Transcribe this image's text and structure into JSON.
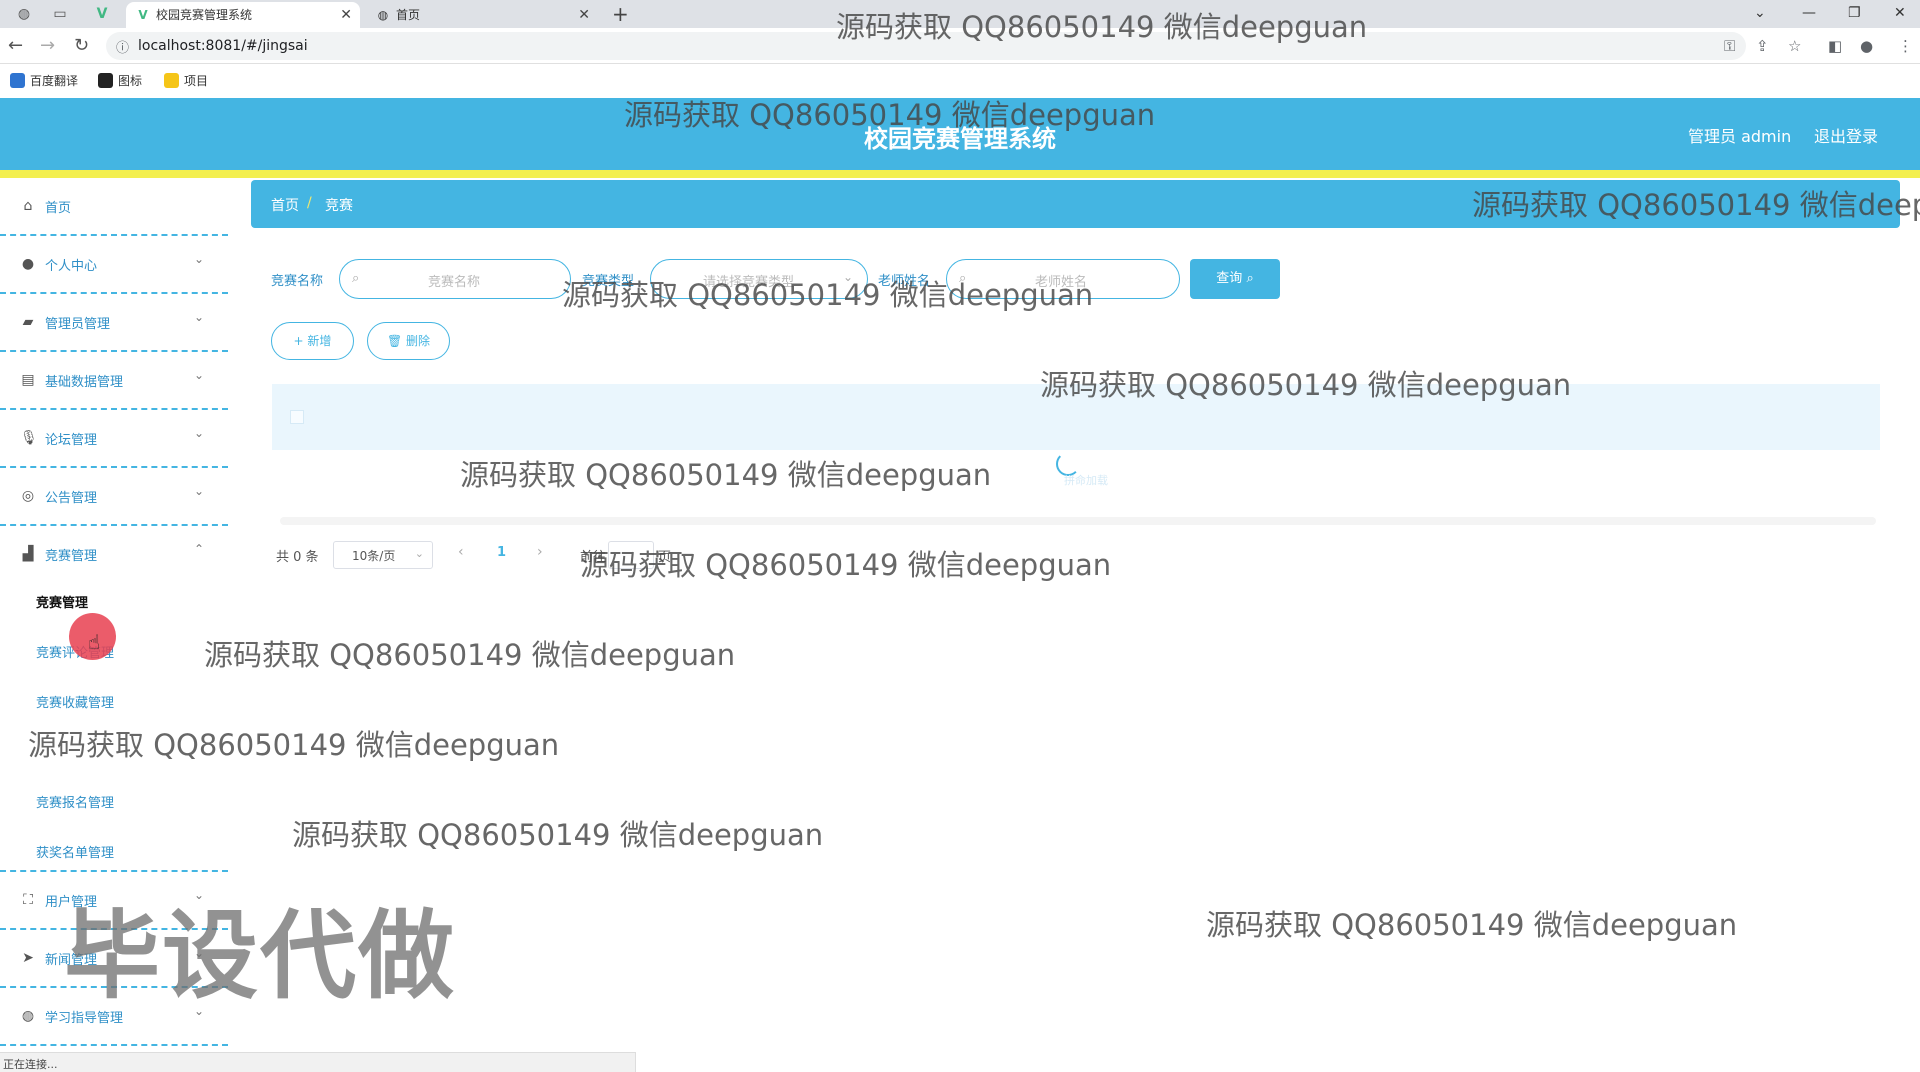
{
  "browser": {
    "tabs": [
      {
        "title": "校园竞赛管理系统",
        "active": true
      },
      {
        "title": "首页",
        "active": false
      }
    ],
    "url": "localhost:8081/#/jingsai",
    "bookmarks": [
      "百度翻译",
      "图标",
      "项目"
    ],
    "status_text": "正在连接..."
  },
  "header": {
    "title": "校园竞赛管理系统",
    "user": "管理员 admin",
    "logout": "退出登录",
    "colors": {
      "primary": "#44b5e2",
      "accent": "#f3ef4f"
    }
  },
  "sidebar": {
    "items": [
      {
        "label": "首页",
        "icon": "home-icon"
      },
      {
        "label": "个人中心",
        "icon": "user-icon"
      },
      {
        "label": "管理员管理",
        "icon": "people-icon"
      },
      {
        "label": "基础数据管理",
        "icon": "list-icon"
      },
      {
        "label": "论坛管理",
        "icon": "mic-icon"
      },
      {
        "label": "公告管理",
        "icon": "compass-icon"
      },
      {
        "label": "竞赛管理",
        "icon": "briefcase-icon",
        "expanded": true
      },
      {
        "label": "用户管理",
        "icon": "fullscreen-icon"
      },
      {
        "label": "新闻管理",
        "icon": "send-icon"
      },
      {
        "label": "学习指导管理",
        "icon": "globe-icon"
      }
    ],
    "sub_items": [
      {
        "label": "竞赛管理",
        "active": true
      },
      {
        "label": "竞赛评论管理",
        "active": false
      },
      {
        "label": "竞赛收藏管理",
        "active": false
      },
      {
        "label": "竞赛报名管理",
        "active": false
      },
      {
        "label": "获奖名单管理",
        "active": false
      }
    ]
  },
  "breadcrumb": {
    "home": "首页",
    "current": "竞赛"
  },
  "filters": {
    "name_label": "竞赛名称",
    "name_placeholder": "竞赛名称",
    "type_label": "竞赛类型",
    "type_placeholder": "请选择竞赛类型",
    "teacher_label": "老师姓名",
    "teacher_placeholder": "老师姓名",
    "query_button": "查询"
  },
  "actions": {
    "add": "新增",
    "delete": "删除"
  },
  "table": {
    "loading_text": "拼命加载"
  },
  "pagination": {
    "total": "共 0 条",
    "page_size": "10条/页",
    "current_page": "1",
    "goto": "前往",
    "page_suffix": "页"
  },
  "watermark": "源码获取 QQ86050149 微信deepguan",
  "stamp": "毕设代做"
}
